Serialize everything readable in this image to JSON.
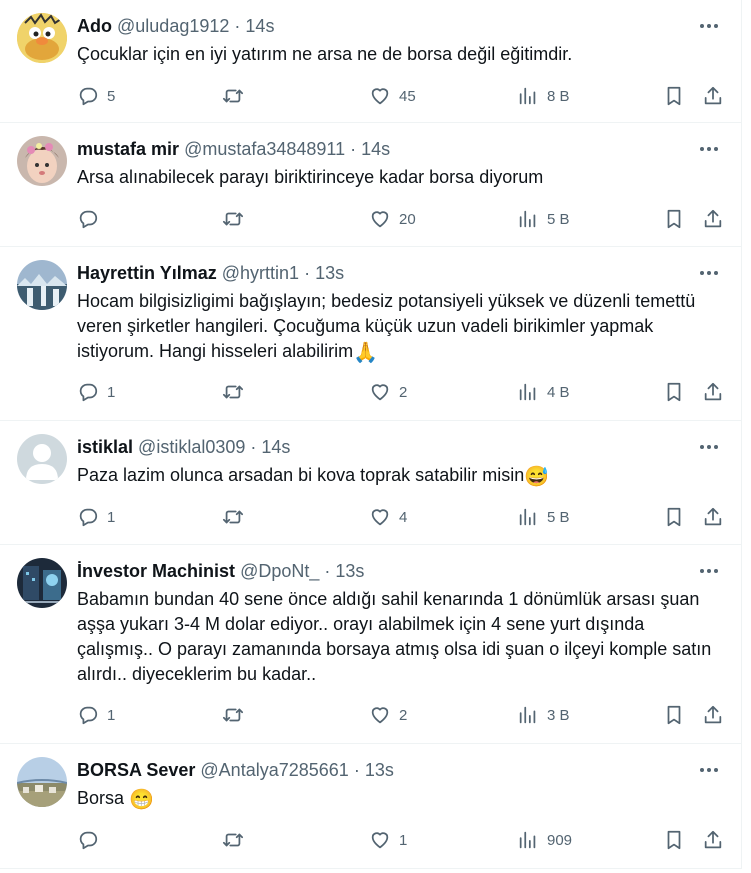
{
  "tweets": [
    {
      "name": "Ado",
      "handle": "@uludag1912",
      "time": "14s",
      "text": "Çocuklar için en iyi yatırım ne arsa ne de borsa değil eğitimdir.",
      "emoji": "",
      "replies": "5",
      "retweets": "",
      "likes": "45",
      "views": "8 B"
    },
    {
      "name": "mustafa mir",
      "handle": "@mustafa34848911",
      "time": "14s",
      "text": "Arsa alınabilecek parayı biriktirinceye kadar borsa diyorum",
      "emoji": "",
      "replies": "",
      "retweets": "",
      "likes": "20",
      "views": "5 B"
    },
    {
      "name": "Hayrettin Yılmaz",
      "handle": "@hyrttin1",
      "time": "13s",
      "text": "Hocam bilgisizligimi bağışlayın; bedesiz potansiyeli yüksek ve düzenli temettü veren şirketler hangileri. Çocuğuma küçük uzun vadeli birikimler yapmak istiyorum. Hangi hisseleri alabilirim",
      "emoji": "🙏",
      "replies": "1",
      "retweets": "",
      "likes": "2",
      "views": "4 B"
    },
    {
      "name": "istiklal",
      "handle": "@istiklal0309",
      "time": "14s",
      "text": "Paza lazim olunca arsadan bi kova toprak satabilir misin",
      "emoji": "😅",
      "replies": "1",
      "retweets": "",
      "likes": "4",
      "views": "5 B"
    },
    {
      "name": "İnvestor Machinist",
      "handle": "@DpoNt_",
      "time": "13s",
      "text": "Babamın bundan 40 sene önce aldığı sahil kenarında 1 dönümlük arsası şuan aşşa yukarı 3-4 M dolar ediyor.. orayı alabilmek için 4 sene yurt dışında çalışmış.. O parayı zamanında borsaya atmış olsa idi şuan o ilçeyi komple satın alırdı.. diyeceklerim bu kadar..",
      "emoji": "",
      "replies": "1",
      "retweets": "",
      "likes": "2",
      "views": "3 B"
    },
    {
      "name": "BORSA Sever",
      "handle": "@Antalya7285661",
      "time": "13s",
      "text": "Borsa ",
      "emoji": "😁",
      "replies": "",
      "retweets": "",
      "likes": "1",
      "views": "909"
    }
  ],
  "separator": "·",
  "icons": {
    "reply": "reply-icon",
    "retweet": "retweet-icon",
    "like": "heart-icon",
    "views": "views-icon",
    "bookmark": "bookmark-icon",
    "share": "share-icon",
    "more": "more-icon"
  },
  "colors": {
    "text": "#0f1419",
    "secondary": "#536471",
    "border": "#eff3f4"
  }
}
